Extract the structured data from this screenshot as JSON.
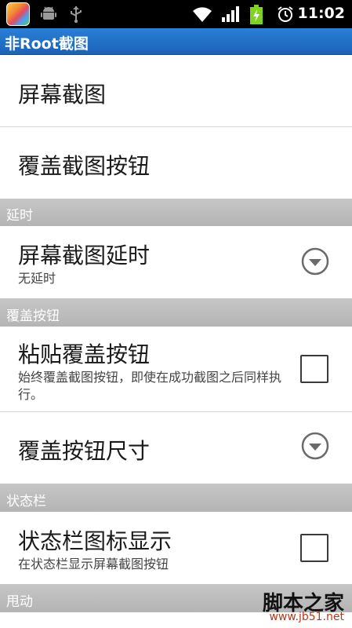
{
  "status_bar": {
    "time": "11:02",
    "icons": [
      "app-launcher-icon",
      "android-debug-icon",
      "usb-icon",
      "wifi-icon",
      "signal-icon",
      "battery-charging-icon",
      "alarm-icon"
    ],
    "battery_color": "#7ed321"
  },
  "app": {
    "title": "非Root截图",
    "title_bar_color": "#1f6fc5"
  },
  "preferences": {
    "screenshot": {
      "title": "屏幕截图"
    },
    "overlay_button": {
      "title": "覆盖截图按钮"
    },
    "delay_section": {
      "header": "延时",
      "screenshot_delay": {
        "title": "屏幕截图延时",
        "summary": "无延时",
        "control": "dropdown-icon"
      }
    },
    "overlay_section": {
      "header": "覆盖按钮",
      "sticky_overlay": {
        "title": "粘贴覆盖按钮",
        "summary": "始终覆盖截图按钮，即使在成功截图之后同样执行。",
        "checked": false
      },
      "overlay_size": {
        "title": "覆盖按钮尺寸",
        "control": "dropdown-icon"
      }
    },
    "statusbar_section": {
      "header": "状态栏",
      "statusbar_icon": {
        "title": "状态栏图标显示",
        "summary": "在状态栏显示屏幕截图按钮",
        "checked": false
      }
    },
    "shake_section": {
      "header": "甩动"
    }
  },
  "watermark": {
    "text": "脚本之家",
    "url": "www.jb51.net"
  }
}
